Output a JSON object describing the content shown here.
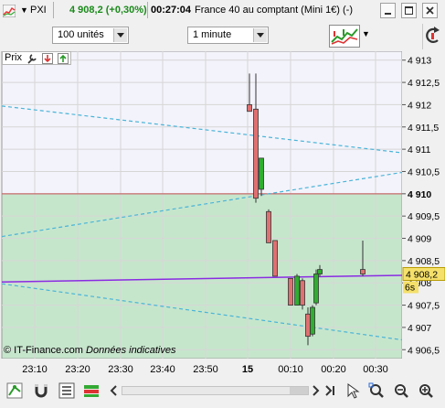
{
  "title_bar": {
    "symbol": "PXI",
    "price": "4 908,2 (+0,30%)",
    "time": "00:27:04",
    "instrument": "France 40 au comptant (Mini 1€) (-)"
  },
  "toolbar": {
    "units_select": "100 unités",
    "period_select": "1 minute"
  },
  "chart": {
    "panel_label": "Prix",
    "copyright": "© IT-Finance.com",
    "notice": "Données indicatives",
    "current_price_label": "4 908,2",
    "countdown_label": "6s",
    "ref_level_label": "4 910",
    "colors": {
      "up": "#2fae2f",
      "down": "#e07070",
      "trend": "#8a2be2",
      "channel": "#49b4d8",
      "ref": "#c05050"
    }
  },
  "chart_data": {
    "type": "candlestick",
    "y_ticks": [
      "4 913",
      "4 912,5",
      "4 912",
      "4 911,5",
      "4 911",
      "4 910,5",
      "4 910",
      "4 909,5",
      "4 909",
      "4 908,5",
      "4 908",
      "4 907,5",
      "4 907",
      "4 906,5"
    ],
    "ylim": [
      4906.3,
      4913.2
    ],
    "x_ticks": [
      "23:10",
      "23:20",
      "23:30",
      "23:40",
      "23:50",
      "15",
      "00:10",
      "00:20",
      "00:30"
    ],
    "candles": [
      {
        "open": 4912.0,
        "high": 4912.7,
        "low": 4911.95,
        "close": 4911.85
      },
      {
        "open": 4911.9,
        "high": 4912.7,
        "low": 4909.8,
        "close": 4909.9
      },
      {
        "open": 4910.1,
        "high": 4910.2,
        "low": 4909.95,
        "close": 4910.8
      },
      {
        "open": 4909.6,
        "high": 4909.65,
        "low": 4908.9,
        "close": 4908.9
      },
      {
        "open": 4908.95,
        "high": 4908.9,
        "low": 4908.15,
        "close": 4908.15
      },
      {
        "open": 4908.1,
        "high": 4908.1,
        "low": 4907.5,
        "close": 4907.5
      },
      {
        "open": 4907.5,
        "high": 4908.2,
        "low": 4907.5,
        "close": 4908.15
      },
      {
        "open": 4908.05,
        "high": 4908.1,
        "low": 4907.4,
        "close": 4907.5
      },
      {
        "open": 4907.3,
        "high": 4907.45,
        "low": 4906.6,
        "close": 4906.8
      },
      {
        "open": 4906.85,
        "high": 4907.5,
        "low": 4906.8,
        "close": 4907.45
      },
      {
        "open": 4907.55,
        "high": 4908.3,
        "low": 4907.5,
        "close": 4908.2
      },
      {
        "open": 4908.2,
        "high": 4908.4,
        "low": 4908.15,
        "close": 4908.3
      },
      {
        "open": 4908.3,
        "high": 4908.95,
        "low": 4908.15,
        "close": 4908.2
      }
    ],
    "last_price": 4908.2
  }
}
